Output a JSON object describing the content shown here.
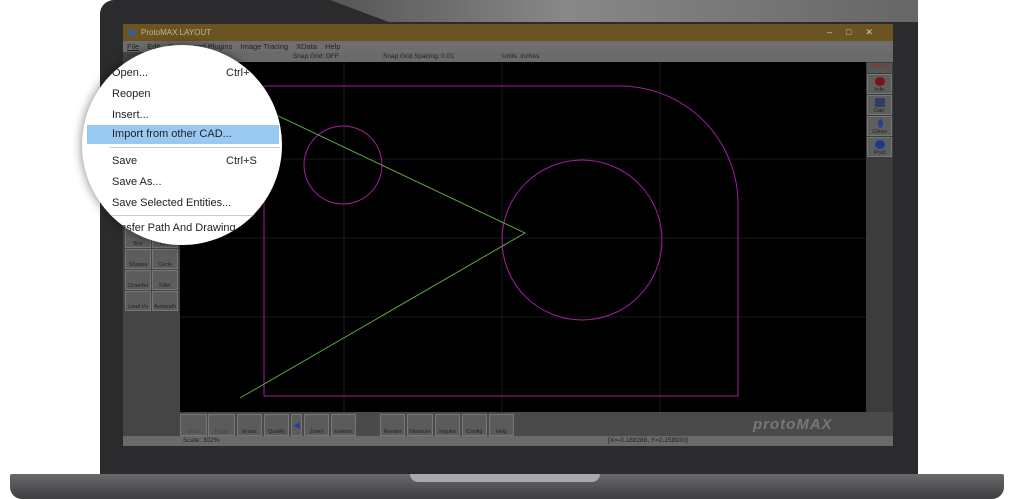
{
  "window": {
    "title": "ProtoMAX LAYOUT",
    "controls": [
      "–",
      "□",
      "✕"
    ]
  },
  "menubar": [
    "File",
    "Edit",
    "Scripts and Plugins",
    "Image Tracing",
    "XData",
    "Help"
  ],
  "infobar": {
    "snap_grid": "Snap Grid: OFF",
    "snap_spacing": "Snap Grid Spacing: 0.01",
    "units": "Units: inches"
  },
  "file_menu": [
    {
      "label": "Open...",
      "shortcut": "Ctrl+"
    },
    {
      "label": "Reopen",
      "shortcut": ""
    },
    {
      "label": "Insert...",
      "shortcut": ""
    },
    {
      "label": "Import from other CAD...",
      "shortcut": "",
      "highlighted": true
    },
    {
      "label": "Save",
      "shortcut": "Ctrl+S"
    },
    {
      "label": "Save As...",
      "shortcut": ""
    },
    {
      "label": "Save Selected Entities...",
      "shortcut": ""
    },
    {
      "label": "Transfer Path And Drawing",
      "shortcut": ""
    }
  ],
  "left_tools": [
    "Box",
    "Line",
    "Shapes",
    "Circle",
    "Chamfer",
    "Fillet",
    "Lead i/o",
    "Autopath"
  ],
  "right_tools": {
    "header": "Special",
    "items": [
      "Info",
      "Calc",
      "Clean",
      "Post"
    ]
  },
  "bottom_tools": [
    "Undo",
    "Redo",
    "Erase",
    "Quality",
    "Zoom",
    "Extents",
    "Render",
    "Measure",
    "Inquire",
    "Config",
    "Help"
  ],
  "status": {
    "scale": "Scale: 302%",
    "coords": "[X=-0.188288, Y=2.158930]"
  },
  "brand": "protoMAX",
  "colors": {
    "outline": "#b020b0",
    "path": "#5fa63a",
    "canvas": "#000000"
  }
}
